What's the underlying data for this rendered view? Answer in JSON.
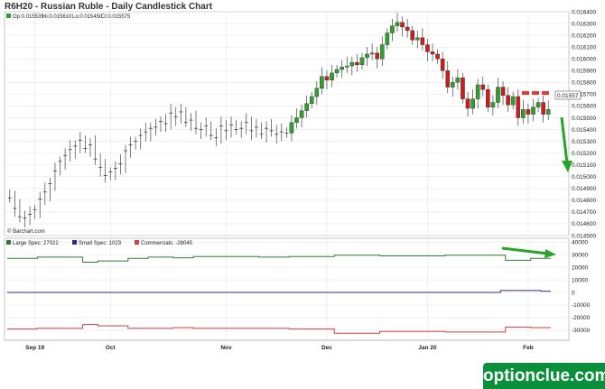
{
  "header": {
    "title": "R6H20 - Russian Ruble - Daily Candlestick Chart"
  },
  "ohlc": {
    "open": "Op:0.015535",
    "high": "Hi:0.015610",
    "low": "Lo:0.015450",
    "close": "Cl:0.015575"
  },
  "credit": "© Barchart.com",
  "last_price": "0.01557",
  "colors": {
    "up": "#2ea02e",
    "down": "#c81e1e",
    "large_spec": "#2e7d32",
    "small_spec": "#2c2c8c",
    "commercials": "#d04040",
    "annotation_red": "#e53935",
    "annotation_green": "#27a327",
    "watermark": "#0a8f3a"
  },
  "watermark": "optionclue.com",
  "chart_data": [
    {
      "type": "candlestick",
      "title": "R6H20 - Russian Ruble - Daily Candlestick Chart",
      "ylim": [
        0.0145,
        0.0164
      ],
      "y_ticks": [
        "0.014500",
        "0.014600",
        "0.014700",
        "0.014800",
        "0.014900",
        "0.015000",
        "0.015100",
        "0.015200",
        "0.015300",
        "0.015400",
        "0.015500",
        "0.015600",
        "0.015700",
        "0.015800",
        "0.015900",
        "0.016000",
        "0.016100",
        "0.016200",
        "0.016300",
        "0.016400"
      ],
      "x_labels": [
        "Sep 19",
        "Oct",
        "Nov",
        "Dec",
        "Jan 20",
        "Feb"
      ],
      "x_label_index": [
        5,
        20,
        43,
        63,
        83,
        103
      ],
      "n_bars": 108,
      "closes": [
        0.01482,
        0.01473,
        0.01466,
        0.01465,
        0.01468,
        0.01472,
        0.01481,
        0.01487,
        0.01494,
        0.01505,
        0.01513,
        0.01518,
        0.01523,
        0.01526,
        0.01531,
        0.01524,
        0.01527,
        0.01515,
        0.01508,
        0.01501,
        0.01504,
        0.01507,
        0.01511,
        0.01522,
        0.01527,
        0.0153,
        0.01535,
        0.01538,
        0.01541,
        0.01542,
        0.01547,
        0.01545,
        0.01554,
        0.01551,
        0.01555,
        0.01546,
        0.01548,
        0.01541,
        0.0154,
        0.01543,
        0.01535,
        0.01533,
        0.01543,
        0.01539,
        0.01544,
        0.0154,
        0.01541,
        0.01546,
        0.01539,
        0.01542,
        0.01536,
        0.01541,
        0.01539,
        0.01536,
        0.01538,
        0.01537,
        0.01546,
        0.0155,
        0.01556,
        0.01562,
        0.01568,
        0.01575,
        0.01585,
        0.01582,
        0.01588,
        0.01591,
        0.01593,
        0.01594,
        0.01597,
        0.01595,
        0.01601,
        0.01604,
        0.01605,
        0.016,
        0.01612,
        0.01622,
        0.01628,
        0.01631,
        0.01627,
        0.01624,
        0.01616,
        0.01618,
        0.01612,
        0.01606,
        0.01604,
        0.016,
        0.0159,
        0.01576,
        0.0158,
        0.01584,
        0.01566,
        0.01558,
        0.01566,
        0.01578,
        0.01574,
        0.01559,
        0.01563,
        0.01576,
        0.01569,
        0.01561,
        0.01568,
        0.0155,
        0.01557,
        0.01553,
        0.01559,
        0.01563,
        0.01553,
        0.01557
      ],
      "annotations": [
        {
          "type": "dashed-line",
          "color": "#e53935",
          "y": 0.01576
        },
        {
          "type": "arrow-down",
          "color": "#27a327"
        }
      ]
    },
    {
      "type": "line",
      "title": "",
      "ylim": [
        -38000,
        43000
      ],
      "y_ticks": [
        "40000",
        "30000",
        "20000",
        "10000",
        "0",
        "-10000",
        "-20000",
        "-30000"
      ],
      "legend_position": "top-left",
      "series": [
        {
          "name": "Large Spec",
          "legend": "Large Spec: 27022",
          "color": "#2e7d32",
          "values": [
            27000,
            27000,
            27000,
            27000,
            27000,
            27000,
            28000,
            28000,
            28000,
            28000,
            28000,
            28000,
            28000,
            28000,
            28000,
            24000,
            24000,
            24000,
            25000,
            25000,
            25000,
            25000,
            25000,
            25000,
            27000,
            27000,
            27000,
            27000,
            28000,
            28000,
            28000,
            28000,
            28000,
            27500,
            27500,
            27500,
            27500,
            28500,
            28500,
            28500,
            28500,
            28500,
            28500,
            28500,
            28500,
            28500,
            28500,
            28500,
            28500,
            28500,
            28000,
            28000,
            28000,
            28000,
            28000,
            28000,
            28500,
            28500,
            28500,
            28500,
            28500,
            28500,
            28500,
            28500,
            28500,
            29500,
            29500,
            29500,
            29500,
            29500,
            29500,
            29500,
            29500,
            29500,
            29000,
            29000,
            29000,
            29000,
            29000,
            29000,
            29000,
            29000,
            29000,
            29000,
            29000,
            29000,
            29000,
            29500,
            29500,
            29500,
            29500,
            29500,
            29500,
            29500,
            29500,
            29500,
            29500,
            29500,
            29500,
            25500,
            25500,
            25500,
            25500,
            25500,
            27000,
            27000,
            27000,
            27000
          ]
        },
        {
          "name": "Small Spec",
          "legend": "Small Spec: 1023",
          "color": "#2c2c8c",
          "values": [
            0,
            0,
            0,
            0,
            0,
            0,
            0,
            0,
            0,
            0,
            0,
            0,
            0,
            0,
            0,
            0,
            0,
            0,
            0,
            0,
            0,
            0,
            0,
            0,
            0,
            0,
            0,
            0,
            0,
            0,
            0,
            0,
            0,
            0,
            0,
            0,
            0,
            0,
            0,
            0,
            0,
            0,
            0,
            0,
            0,
            0,
            0,
            0,
            0,
            0,
            0,
            0,
            0,
            0,
            0,
            0,
            0,
            0,
            0,
            0,
            0,
            0,
            0,
            0,
            0,
            0,
            0,
            0,
            0,
            0,
            0,
            0,
            0,
            0,
            0,
            0,
            0,
            0,
            0,
            0,
            0,
            0,
            0,
            0,
            0,
            0,
            0,
            0,
            0,
            0,
            0,
            0,
            0,
            0,
            0,
            0,
            0,
            0,
            1500,
            1500,
            1500,
            1500,
            1500,
            1500,
            1500,
            1500,
            1000,
            1000
          ]
        },
        {
          "name": "Commercials",
          "legend": "Commercials: -28045",
          "color": "#d04040",
          "values": [
            -29000,
            -29000,
            -29000,
            -29000,
            -29000,
            -29000,
            -28500,
            -28500,
            -28500,
            -28500,
            -28500,
            -28500,
            -28500,
            -28500,
            -28500,
            -25500,
            -25500,
            -25500,
            -26500,
            -26500,
            -26500,
            -26500,
            -26500,
            -26500,
            -28500,
            -28500,
            -28500,
            -28500,
            -28500,
            -28500,
            -28500,
            -28500,
            -28500,
            -28000,
            -28000,
            -28000,
            -28000,
            -28500,
            -28500,
            -28500,
            -28500,
            -28500,
            -28500,
            -28500,
            -28500,
            -28500,
            -28500,
            -28500,
            -28500,
            -28500,
            -28500,
            -28500,
            -28500,
            -28500,
            -28500,
            -28500,
            -29000,
            -29000,
            -29000,
            -29000,
            -29000,
            -29000,
            -29000,
            -29000,
            -29000,
            -32500,
            -32500,
            -32500,
            -32500,
            -32500,
            -32500,
            -32500,
            -32500,
            -32500,
            -31000,
            -31000,
            -31000,
            -31000,
            -31000,
            -31000,
            -31000,
            -31000,
            -31000,
            -31000,
            -31000,
            -31000,
            -31000,
            -31500,
            -31500,
            -31500,
            -31500,
            -31500,
            -31500,
            -31500,
            -31500,
            -31500,
            -31500,
            -31500,
            -31500,
            -27500,
            -27500,
            -27500,
            -27500,
            -27500,
            -28000,
            -28000,
            -28000,
            -28000
          ]
        }
      ],
      "annotations": [
        {
          "type": "arrow-right",
          "color": "#27a327"
        }
      ]
    }
  ]
}
